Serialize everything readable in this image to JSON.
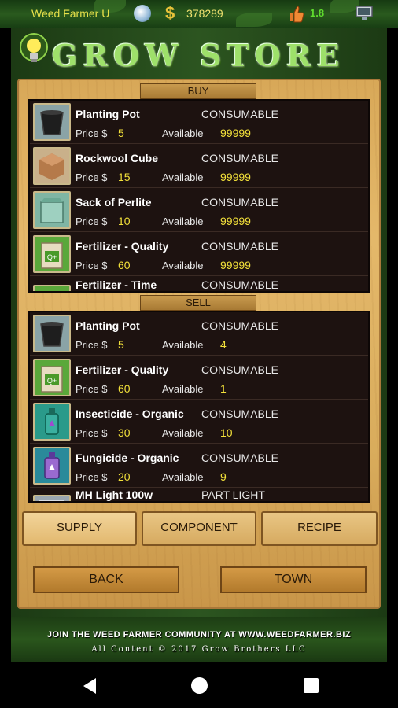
{
  "status_bar": {
    "player_name": "Weed Farmer U",
    "money": "378289",
    "level": "1.8",
    "icons": [
      "seed-icon",
      "dollar-icon",
      "thumbs-up-icon",
      "monitor-icon"
    ]
  },
  "header": {
    "title": "GROW STORE",
    "icon": "lightbulb-icon"
  },
  "buy": {
    "label": "BUY",
    "items": [
      {
        "name": "Planting Pot",
        "type": "CONSUMABLE",
        "price_label": "Price $",
        "price": "5",
        "available_label": "Available",
        "available": "99999",
        "icon": "planting-pot-icon"
      },
      {
        "name": "Rockwool Cube",
        "type": "CONSUMABLE",
        "price_label": "Price $",
        "price": "15",
        "available_label": "Available",
        "available": "99999",
        "icon": "rockwool-cube-icon"
      },
      {
        "name": "Sack of Perlite",
        "type": "CONSUMABLE",
        "price_label": "Price $",
        "price": "10",
        "available_label": "Available",
        "available": "99999",
        "icon": "perlite-sack-icon"
      },
      {
        "name": "Fertilizer - Quality",
        "type": "CONSUMABLE",
        "price_label": "Price $",
        "price": "60",
        "available_label": "Available",
        "available": "99999",
        "icon": "fertilizer-bag-icon"
      }
    ],
    "partial": {
      "name": "Fertilizer - Time",
      "type": "CONSUMABLE"
    }
  },
  "sell": {
    "label": "SELL",
    "items": [
      {
        "name": "Planting Pot",
        "type": "CONSUMABLE",
        "price_label": "Price $",
        "price": "5",
        "available_label": "Available",
        "available": "4",
        "icon": "planting-pot-icon"
      },
      {
        "name": "Fertilizer - Quality",
        "type": "CONSUMABLE",
        "price_label": "Price $",
        "price": "60",
        "available_label": "Available",
        "available": "1",
        "icon": "fertilizer-bag-icon"
      },
      {
        "name": "Insecticide - Organic",
        "type": "CONSUMABLE",
        "price_label": "Price $",
        "price": "30",
        "available_label": "Available",
        "available": "10",
        "icon": "insecticide-bottle-icon"
      },
      {
        "name": "Fungicide - Organic",
        "type": "CONSUMABLE",
        "price_label": "Price $",
        "price": "20",
        "available_label": "Available",
        "available": "9",
        "icon": "fungicide-bottle-icon"
      }
    ],
    "partial": {
      "name": "MH Light 100w",
      "type": "PART LIGHT"
    }
  },
  "tabs": [
    {
      "label": "SUPPLY",
      "active": true
    },
    {
      "label": "COMPONENT",
      "active": false
    },
    {
      "label": "RECIPE",
      "active": false
    }
  ],
  "nav": {
    "back_label": "BACK",
    "town_label": "TOWN"
  },
  "footer": {
    "line1": "JOIN THE WEED FARMER COMMUNITY AT WWW.WEEDFARMER.BIZ",
    "line2": "All Content © 2017 Grow Brothers LLC"
  },
  "colors": {
    "accent_yellow": "#f2e03a",
    "wood": "#d8a858",
    "list_bg": "#1d1210",
    "leaf_green": "#2c5520"
  }
}
